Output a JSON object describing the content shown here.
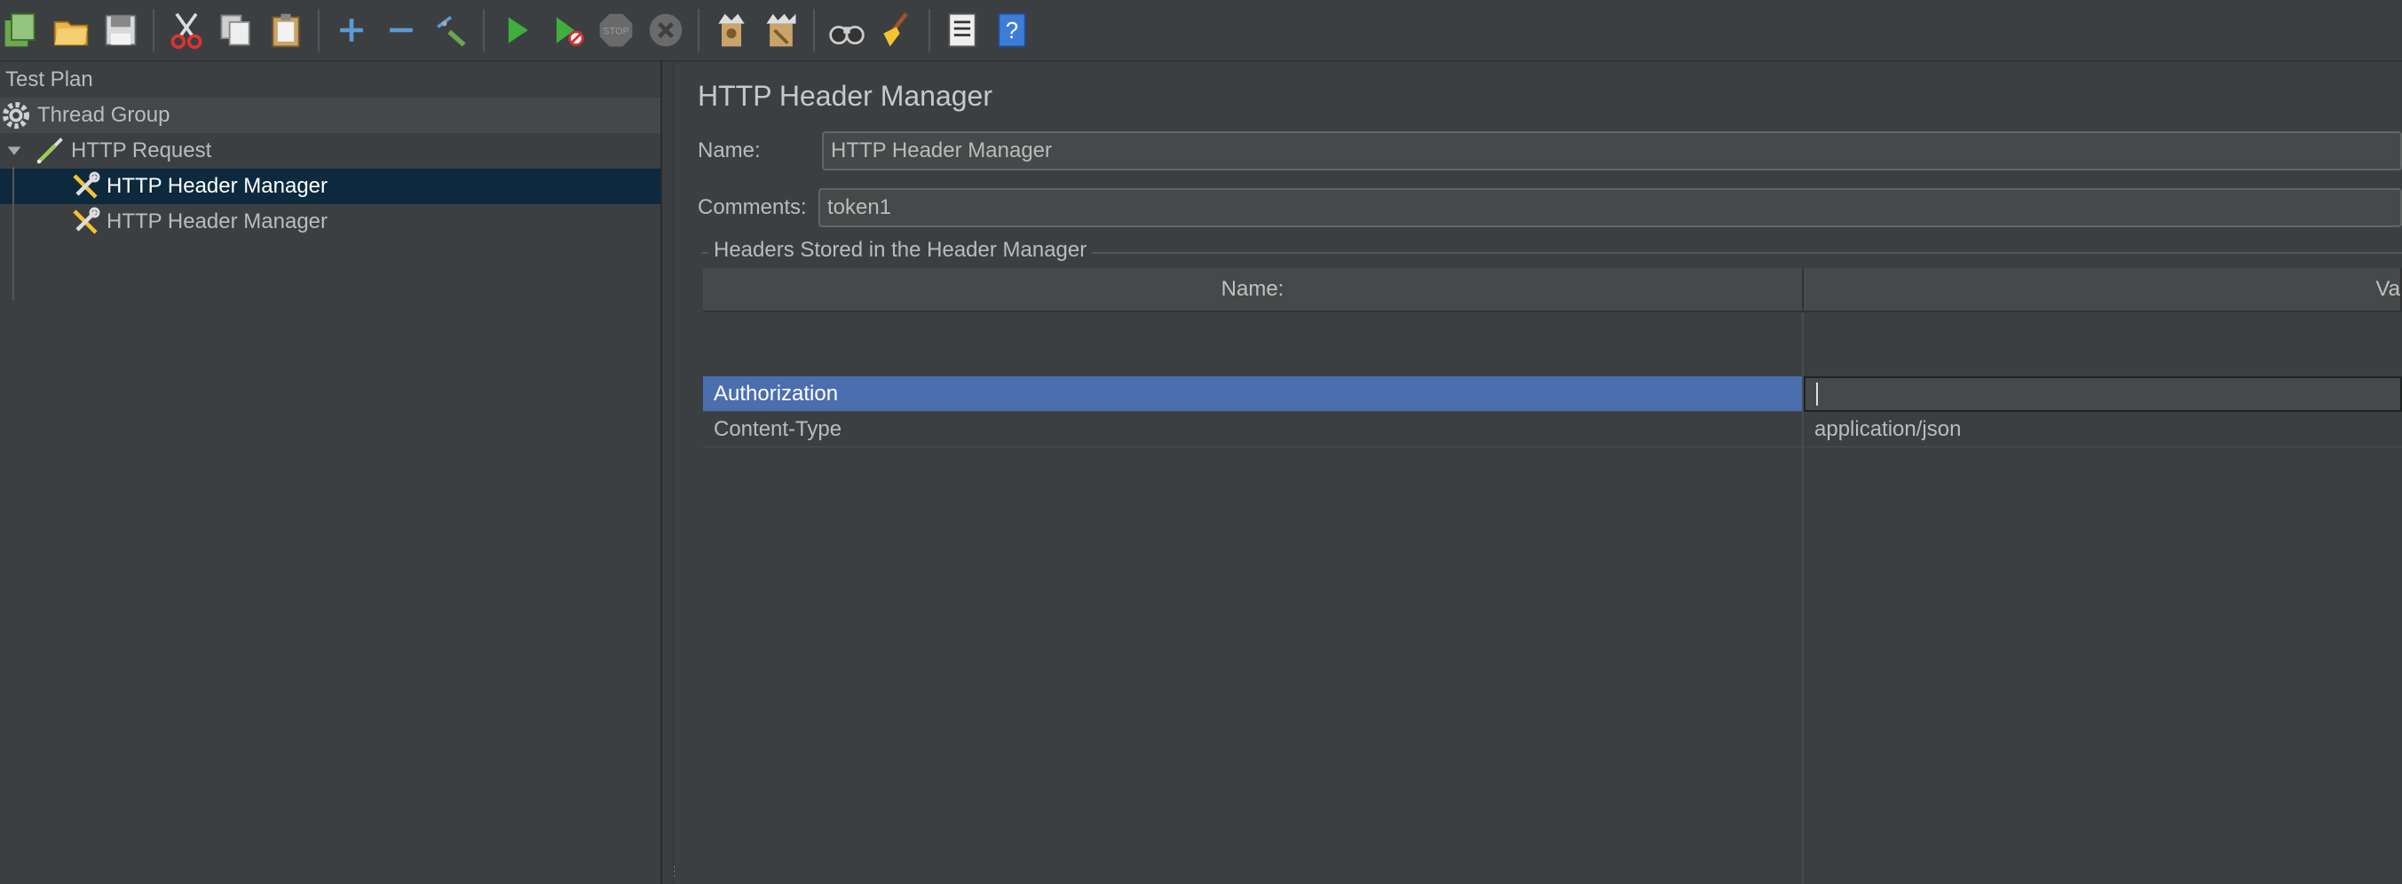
{
  "toolbar": {
    "buttons": [
      {
        "name": "templates",
        "icon": "templates-icon"
      },
      {
        "name": "open",
        "icon": "open-folder-icon"
      },
      {
        "name": "save",
        "icon": "save-icon"
      },
      {
        "name": "cut",
        "icon": "cut-icon"
      },
      {
        "name": "copy",
        "icon": "copy-icon"
      },
      {
        "name": "paste",
        "icon": "paste-icon"
      },
      {
        "name": "expand",
        "icon": "plus-icon"
      },
      {
        "name": "collapse",
        "icon": "minus-icon"
      },
      {
        "name": "toggle",
        "icon": "toggle-icon"
      },
      {
        "name": "start",
        "icon": "play-icon"
      },
      {
        "name": "start-no-pauses",
        "icon": "play-no-timers-icon"
      },
      {
        "name": "stop",
        "icon": "stop-icon"
      },
      {
        "name": "shutdown",
        "icon": "shutdown-icon"
      },
      {
        "name": "clear",
        "icon": "clear-icon"
      },
      {
        "name": "clear-all",
        "icon": "clear-all-icon"
      },
      {
        "name": "search",
        "icon": "binoculars-icon"
      },
      {
        "name": "reset-search",
        "icon": "broom-icon"
      },
      {
        "name": "function-helper",
        "icon": "list-icon"
      },
      {
        "name": "help",
        "icon": "help-icon"
      }
    ]
  },
  "tree": {
    "items": [
      {
        "label": "Test Plan"
      },
      {
        "label": "Thread Group"
      },
      {
        "label": "HTTP Request"
      },
      {
        "label": "HTTP Header Manager"
      },
      {
        "label": "HTTP Header Manager"
      }
    ]
  },
  "main": {
    "title": "HTTP Header Manager",
    "name_label": "Name:",
    "name_value": "HTTP Header Manager",
    "comments_label": "Comments:",
    "comments_value": "token1",
    "fieldset_legend": "Headers Stored in the Header Manager",
    "table": {
      "columns": [
        "Name:",
        "Va"
      ],
      "rows": [
        {
          "name": "Authorization",
          "value": ""
        },
        {
          "name": "Content-Type",
          "value": "application/json"
        }
      ]
    }
  },
  "colors": {
    "background": "#3c3f41",
    "selection_tree": "#0d293e",
    "selection_table": "#4b6eaf"
  }
}
